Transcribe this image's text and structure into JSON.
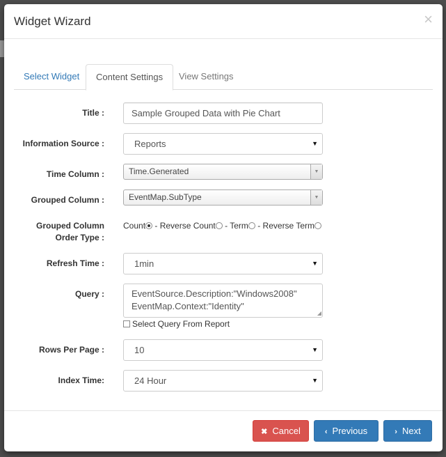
{
  "modal": {
    "title": "Widget Wizard",
    "close_glyph": "×"
  },
  "tabs": [
    {
      "label": "Select Widget"
    },
    {
      "label": "Content Settings"
    },
    {
      "label": "View Settings"
    }
  ],
  "form": {
    "title": {
      "label": "Title :",
      "value": "Sample Grouped Data with Pie Chart"
    },
    "information_source": {
      "label": "Information Source :",
      "value": "Reports"
    },
    "time_column": {
      "label": "Time Column :",
      "value": "Time.Generated"
    },
    "grouped_column": {
      "label": "Grouped Column :",
      "value": "EventMap.SubType"
    },
    "order_type": {
      "label": "Grouped Column Order Type :",
      "options": [
        "Count",
        " - Reverse Count",
        " - Term",
        " - Reverse Term"
      ],
      "selected": "Count"
    },
    "refresh_time": {
      "label": "Refresh Time :",
      "value": "1min"
    },
    "query": {
      "label": "Query :",
      "line1": "EventSource.Description:\"Windows2008\"",
      "line2": "EventMap.Context:\"Identity\"",
      "checkbox_label": "Select Query From Report"
    },
    "rows_per_page": {
      "label": "Rows Per Page :",
      "value": "10"
    },
    "index_time": {
      "label": "Index Time:",
      "value": "24 Hour"
    }
  },
  "footer": {
    "cancel_label": "Cancel",
    "previous_label": "Previous",
    "next_label": "Next"
  },
  "colors": {
    "primary": "#337ab7",
    "danger": "#d9534f"
  },
  "icons": {
    "close": "close-icon",
    "cancel": "times-icon",
    "previous": "chevron-left-icon",
    "next": "chevron-right-icon",
    "select_caret": "caret-down-icon"
  }
}
